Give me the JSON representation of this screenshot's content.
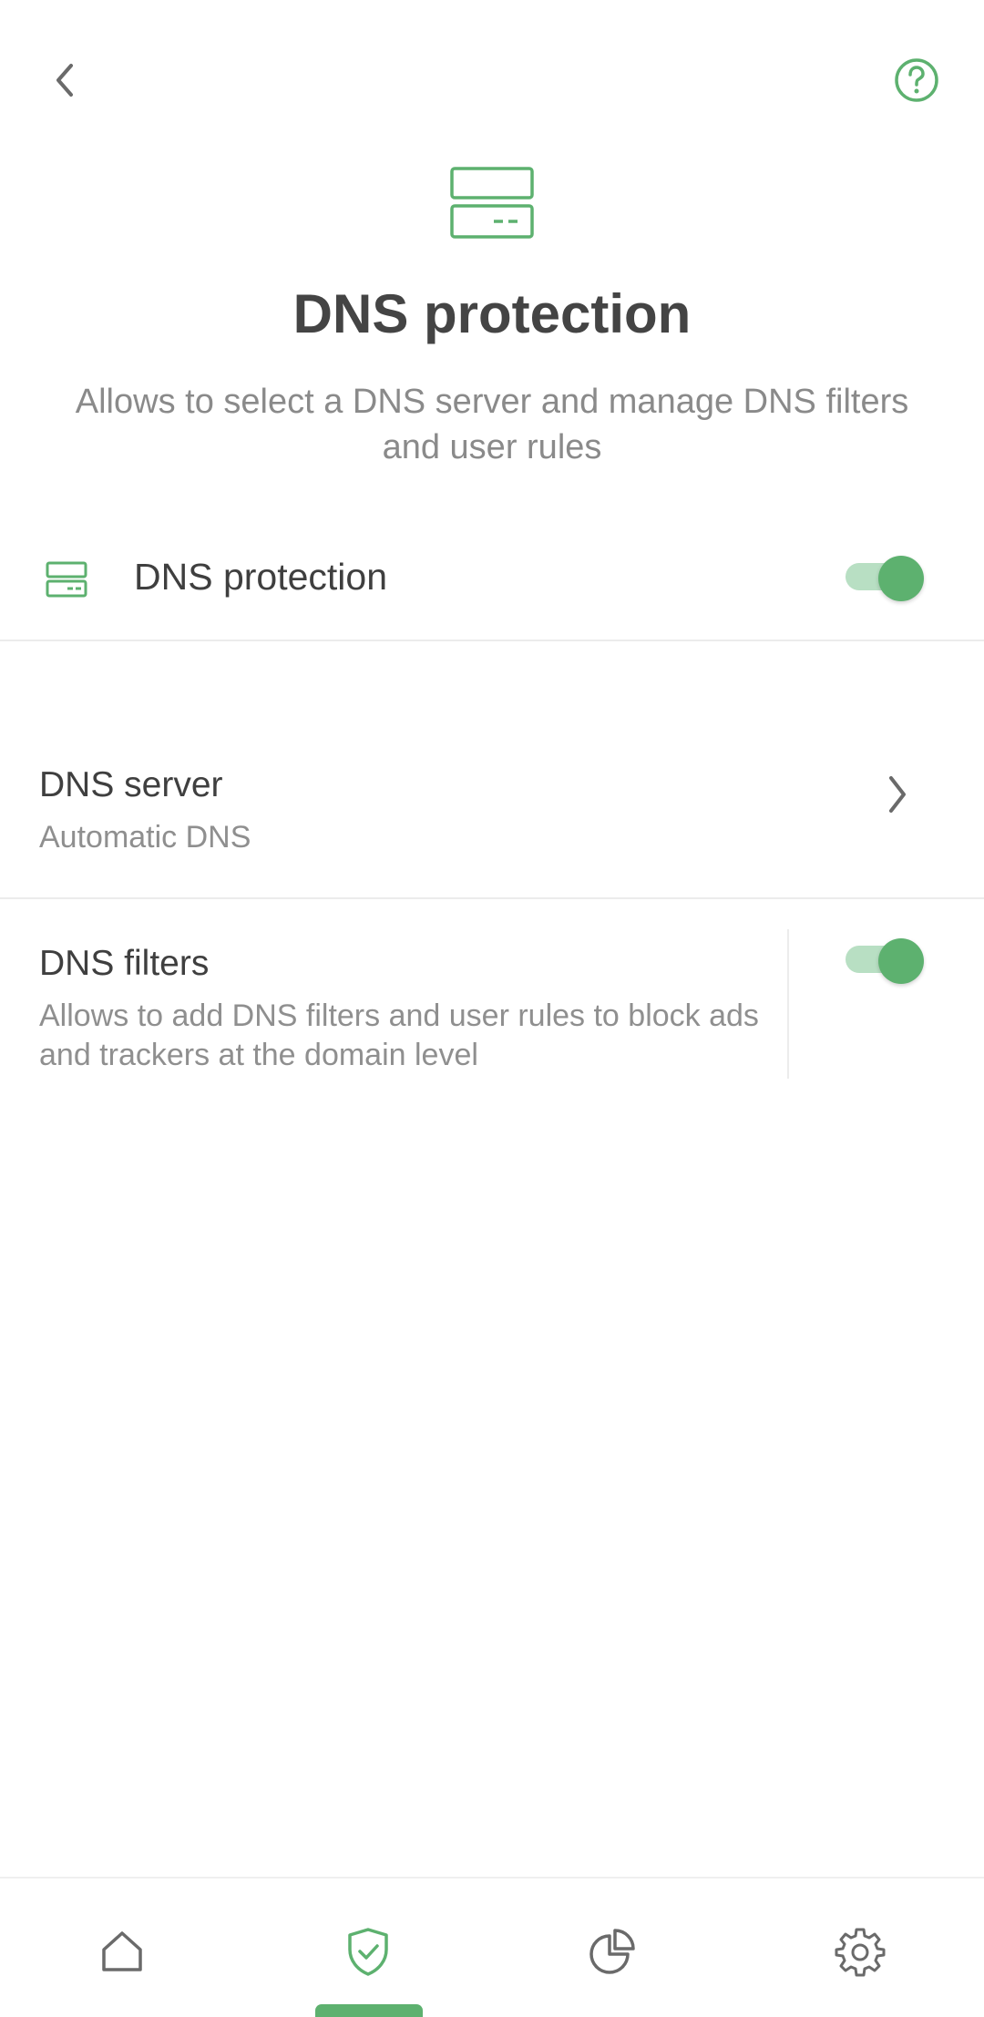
{
  "header": {
    "title": "DNS protection",
    "subtitle": "Allows to select a DNS server and manage DNS filters and user rules"
  },
  "main_toggle": {
    "label": "DNS protection",
    "enabled": true
  },
  "dns_server": {
    "title": "DNS server",
    "value": "Automatic DNS"
  },
  "dns_filters": {
    "title": "DNS filters",
    "description": "Allows to add DNS filters and user rules to block ads and trackers at the domain level",
    "enabled": true
  },
  "bottom_nav": {
    "items": [
      {
        "icon": "home-icon"
      },
      {
        "icon": "shield-check-icon",
        "active": true
      },
      {
        "icon": "pie-chart-icon"
      },
      {
        "icon": "gear-icon"
      }
    ]
  },
  "colors": {
    "accent": "#5db16f",
    "accent_light": "#b8dfc3",
    "title_text": "#444444",
    "secondary_text": "#8a8a8a",
    "divider": "#ececec"
  }
}
